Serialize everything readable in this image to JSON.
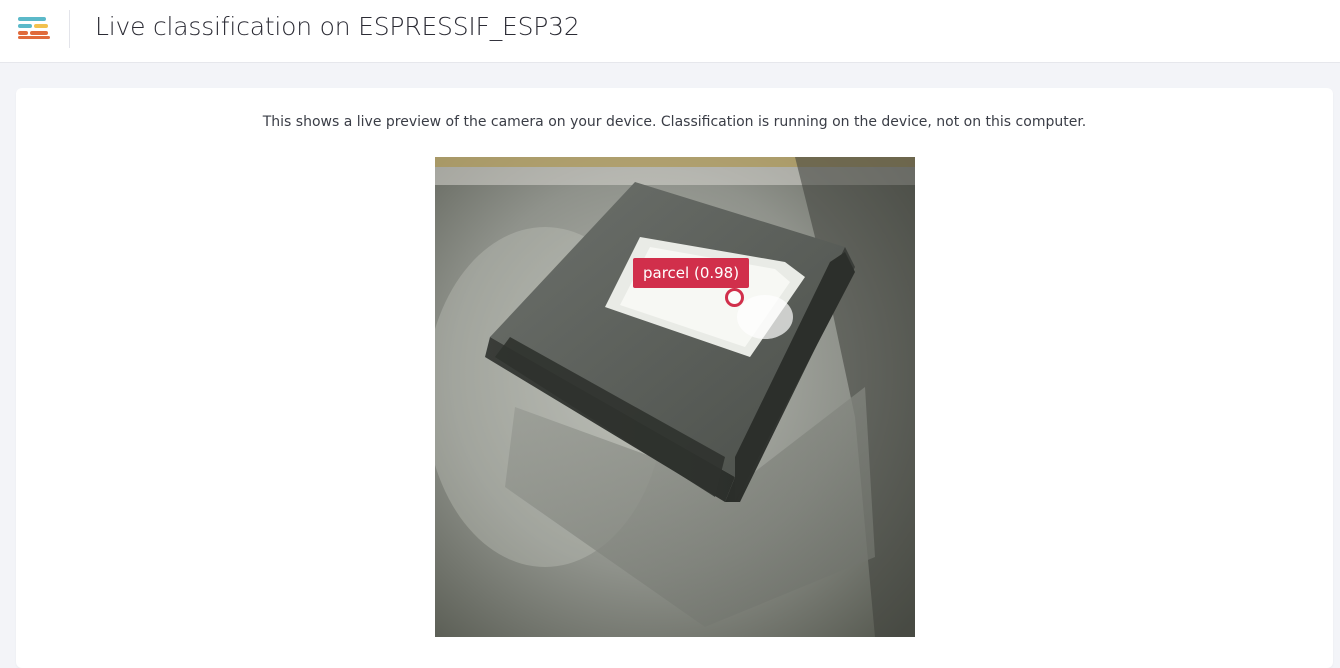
{
  "header": {
    "title": "Live classification on ESPRESSIF_ESP32",
    "logo_icon": "edge-impulse-logo-icon"
  },
  "main": {
    "description": "This shows a live preview of the camera on your device. Classification is running on the device, not on this computer.",
    "preview": {
      "image_subject": "camera-feed-image",
      "detection": {
        "label": "parcel (0.98)",
        "color": "#d12f4b"
      }
    }
  },
  "colors": {
    "background": "#f3f4f8",
    "card": "#ffffff",
    "accent": "#d12f4b"
  }
}
